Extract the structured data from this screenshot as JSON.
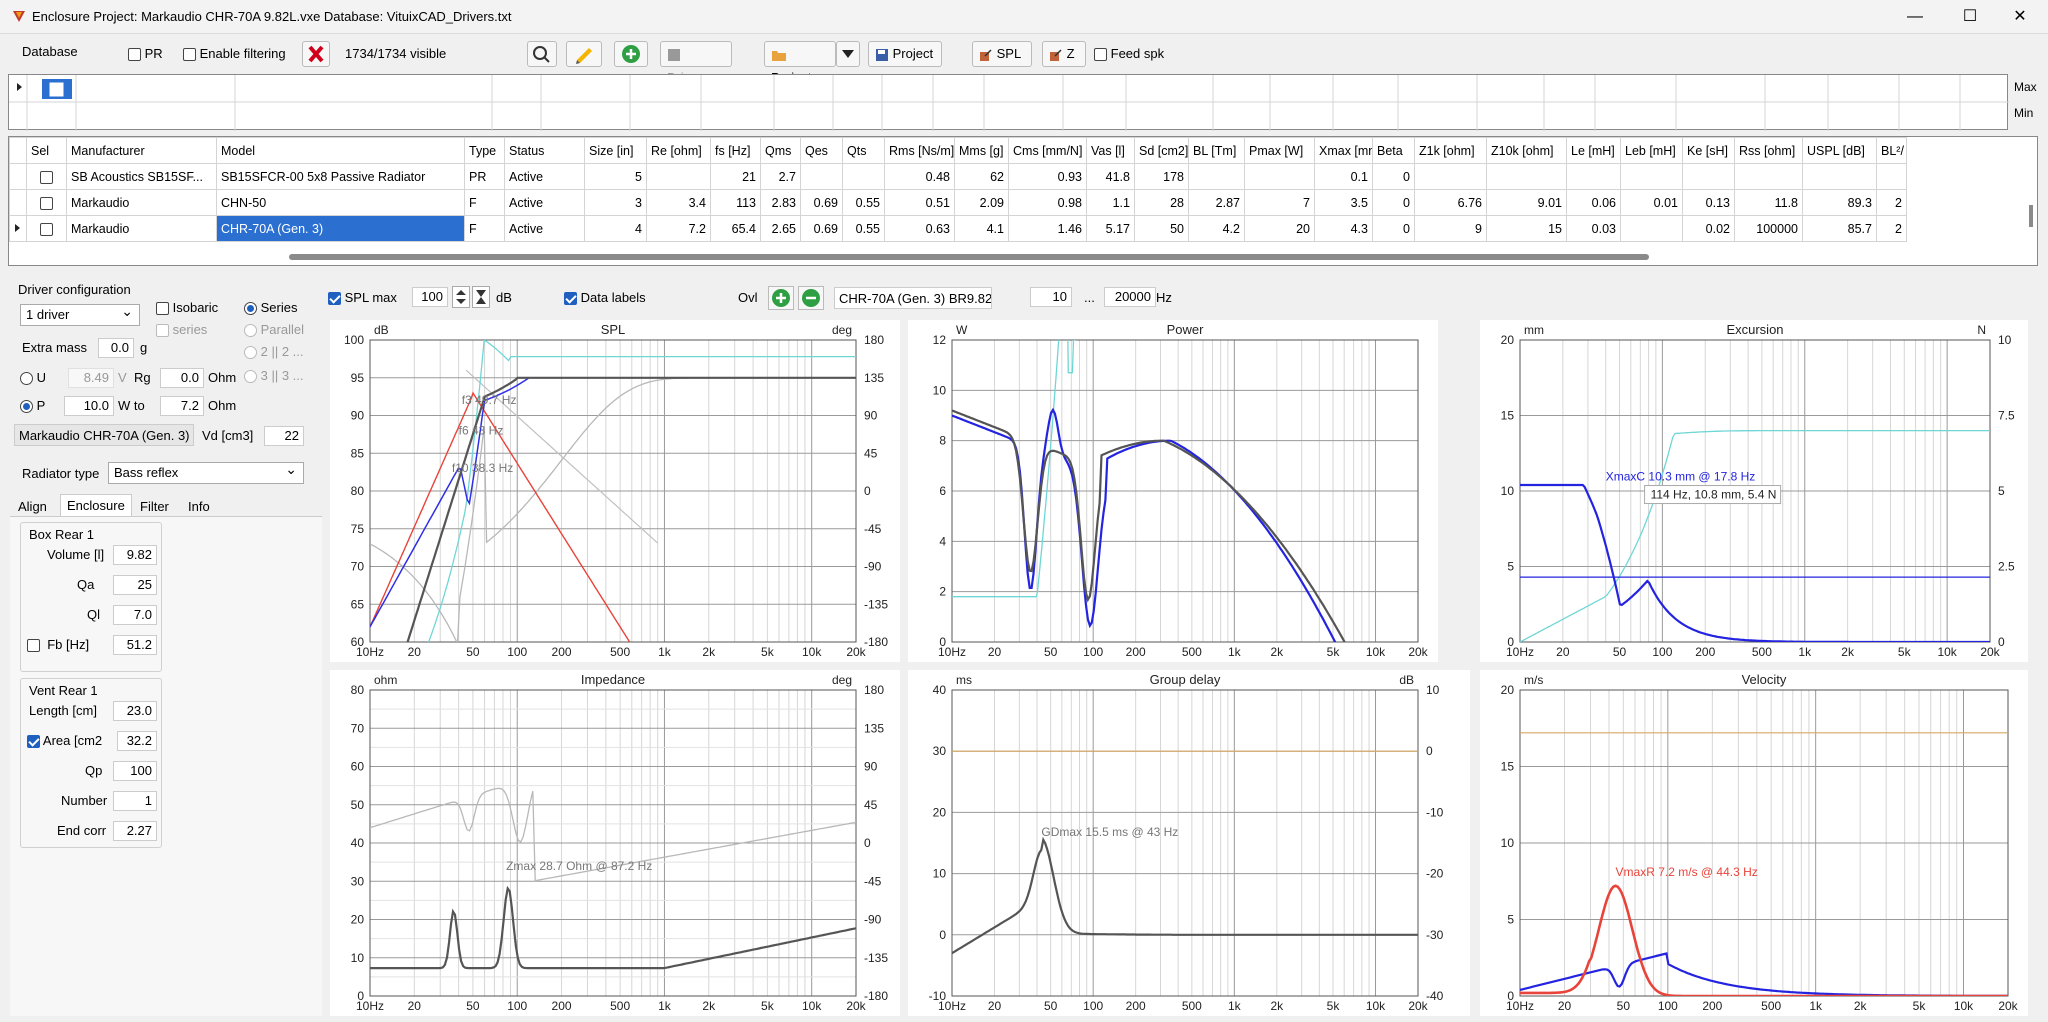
{
  "window": {
    "title": "Enclosure Project: Markaudio CHR-70A 9.82L.vxe  Database: VituixCAD_Drivers.txt",
    "minimize": "—",
    "maximize": "☐",
    "close": "✕"
  },
  "toolbar": {
    "database_label": "Database",
    "pr_label": "PR",
    "filter_label": "Enable filtering",
    "visible_count": "1734/1734 visible",
    "drivers_label": "Drivers",
    "project_open_label": "Project",
    "project_save_label": "Project",
    "spl_label": "SPL",
    "z_label": "Z",
    "feed_label": "Feed spk"
  },
  "filter_row": {
    "max": "Max",
    "min": "Min"
  },
  "table": {
    "columns": [
      "Sel",
      "Manufacturer",
      "Model",
      "Type",
      "Status",
      "Size [in]",
      "Re [ohm]",
      "fs [Hz]",
      "Qms",
      "Qes",
      "Qts",
      "Rms [Ns/m]",
      "Mms [g]",
      "Cms [mm/N]",
      "Vas [l]",
      "Sd [cm2]",
      "BL [Tm]",
      "Pmax [W]",
      "Xmax [mm]",
      "Beta",
      "Z1k [ohm]",
      "Z10k [ohm]",
      "Le [mH]",
      "Leb [mH]",
      "Ke [sH]",
      "Rss [ohm]",
      "USPL [dB]",
      "BL²/"
    ],
    "rows": [
      [
        "",
        "SB Acoustics SB15SF...",
        "SB15SFCR-00 5x8 Passive Radiator",
        "PR",
        "Active",
        "5",
        "",
        "21",
        "2.7",
        "",
        "",
        "0.48",
        "62",
        "0.93",
        "41.8",
        "178",
        "",
        "",
        "0.1",
        "0",
        "",
        "",
        "",
        "",
        "",
        "",
        "",
        ""
      ],
      [
        "",
        "Markaudio",
        "CHN-50",
        "F",
        "Active",
        "3",
        "3.4",
        "113",
        "2.83",
        "0.69",
        "0.55",
        "0.51",
        "2.09",
        "0.98",
        "1.1",
        "28",
        "2.87",
        "7",
        "3.5",
        "0",
        "6.76",
        "9.01",
        "0.06",
        "0.01",
        "0.13",
        "11.8",
        "89.3",
        "2"
      ],
      [
        "",
        "Markaudio",
        "CHR-70A (Gen. 3)",
        "F",
        "Active",
        "4",
        "7.2",
        "65.4",
        "2.65",
        "0.69",
        "0.55",
        "0.63",
        "4.1",
        "1.46",
        "5.17",
        "50",
        "4.2",
        "20",
        "4.3",
        "0",
        "9",
        "15",
        "0.03",
        "",
        "0.02",
        "100000",
        "85.7",
        "2"
      ]
    ]
  },
  "driver_config": {
    "title": "Driver configuration",
    "count": "1 driver",
    "isobaric": "Isobaric",
    "series": "Series",
    "series2": "series",
    "parallel": "Parallel",
    "p2": "2 || 2 ...",
    "p3": "3 || 3 ...",
    "extra_mass_label": "Extra mass",
    "extra_mass": "0.0",
    "g": "g",
    "u_label": "U",
    "u_value": "8.49",
    "v": "V",
    "rg_label": "Rg",
    "rg_value": "0.0",
    "ohm1": "Ohm",
    "p_label": "P",
    "p_value": "10.0",
    "wto": "W to",
    "wto_value": "7.2",
    "ohm2": "Ohm",
    "driver_name": "Markaudio CHR-70A (Gen. 3)",
    "vd_label": "Vd [cm3]",
    "vd_value": "22",
    "radiator_label": "Radiator type",
    "radiator": "Bass reflex"
  },
  "tabs": [
    "Align",
    "Enclosure",
    "Filter",
    "Info"
  ],
  "box": {
    "title": "Box Rear 1",
    "volume_label": "Volume [l]",
    "volume": "9.82",
    "qa_label": "Qa",
    "qa": "25",
    "ql_label": "Ql",
    "ql": "7.0",
    "fb_label": "Fb [Hz]",
    "fb": "51.2"
  },
  "vent": {
    "title": "Vent Rear 1",
    "length_label": "Length [cm]",
    "length": "23.0",
    "area_label": "Area [cm2",
    "area": "32.2",
    "qp_label": "Qp",
    "qp": "100",
    "number_label": "Number",
    "number": "1",
    "endcorr_label": "End corr",
    "endcorr": "2.27"
  },
  "graph_bar": {
    "splmax_label": "SPL max",
    "splmax": "100",
    "db": "dB",
    "datalabels": "Data labels",
    "ovl": "Ovl",
    "overlay_name": "CHR-70A (Gen. 3) BR9.82",
    "fmin": "10",
    "dots": "...",
    "fmax": "20000",
    "hz": "Hz"
  },
  "graphs": {
    "spl": {
      "title": "SPL",
      "unit_left": "dB",
      "unit_right": "deg",
      "yl": [
        "100",
        "95",
        "90",
        "85",
        "80",
        "75",
        "70",
        "65",
        "60"
      ],
      "yr": [
        "180",
        "135",
        "90",
        "45",
        "0",
        "-45",
        "-90",
        "-135",
        "-180"
      ],
      "ann": [
        "f3 49.7 Hz",
        "f6 43 Hz",
        "f10 38.3 Hz"
      ]
    },
    "power": {
      "title": "Power",
      "unit_left": "W",
      "yl": [
        "12",
        "10",
        "8",
        "6",
        "4",
        "2",
        "0"
      ]
    },
    "excursion": {
      "title": "Excursion",
      "unit_left": "mm",
      "unit_right": "N",
      "yl": [
        "20",
        "15",
        "10",
        "5",
        "0"
      ],
      "yr": [
        "10",
        "7.5",
        "5",
        "2.5",
        "0"
      ],
      "ann": "XmaxC 10.3 mm  @ 17.8 Hz",
      "tooltip": "114 Hz, 10.8 mm, 5.4 N"
    },
    "impedance": {
      "title": "Impedance",
      "unit_left": "ohm",
      "unit_right": "deg",
      "yl": [
        "80",
        "70",
        "60",
        "50",
        "40",
        "30",
        "20",
        "10",
        "0"
      ],
      "yr": [
        "180",
        "135",
        "90",
        "45",
        "0",
        "-45",
        "-90",
        "-135",
        "-180"
      ],
      "ann": "Zmax 28.7 Ohm @ 87.2 Hz"
    },
    "gd": {
      "title": "Group delay",
      "unit_left": "ms",
      "unit_right": "dB",
      "yl": [
        "40",
        "30",
        "20",
        "10",
        "0",
        "-10"
      ],
      "yr": [
        "10",
        "0",
        "-10",
        "-20",
        "-30",
        "-40"
      ],
      "ann": "GDmax 15.5 ms  @ 43 Hz"
    },
    "velocity": {
      "title": "Velocity",
      "unit_left": "m/s",
      "yl": [
        "20",
        "15",
        "10",
        "5",
        "0"
      ],
      "ann": "VmaxR 7.2 m/s @ 44.3 Hz"
    },
    "xticks": [
      "10Hz",
      "20",
      "50",
      "100",
      "200",
      "500",
      "1k",
      "2k",
      "5k",
      "10k",
      "20k"
    ]
  }
}
